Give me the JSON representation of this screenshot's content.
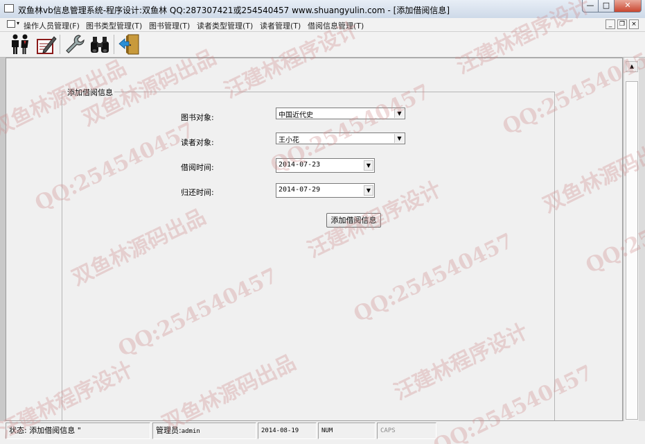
{
  "window": {
    "title": "双鱼林vb信息管理系统-程序设计:双鱼林 QQ:287307421或254540457 www.shuangyulin.com - [添加借阅信息]",
    "min_label": "—",
    "max_label": "□",
    "close_label": "✕"
  },
  "menu": {
    "items": [
      "操作人员管理(F)",
      "图书类型管理(T)",
      "图书管理(T)",
      "读者类型管理(T)",
      "读者管理(T)",
      "借阅信息管理(T)"
    ],
    "child_min": "_",
    "child_restore": "❐",
    "child_close": "×"
  },
  "toolbar": {
    "icons": [
      "people-icon",
      "edit-notebook-icon",
      "wrench-icon",
      "binoculars-icon",
      "exit-door-icon"
    ]
  },
  "form": {
    "frame_title": "添加借阅信息",
    "book_label": "图书对象:",
    "book_value": "中国近代史",
    "reader_label": "读者对象:",
    "reader_value": "王小花",
    "borrow_label": "借阅时间:",
    "borrow_date": "2014-07-23",
    "return_label": "归还时间:",
    "return_date": "2014-07-29",
    "submit_label": "添加借阅信息"
  },
  "status": {
    "state": "状态: 添加借阅信息 \"",
    "admin_label": "管理员:",
    "admin_name": "admin",
    "date": "2014-08-19",
    "num": "NUM",
    "caps": "CAPS"
  },
  "watermark": {
    "texts": [
      "双鱼林源码出品",
      "汪建林程序设计",
      "QQ:254540457"
    ]
  },
  "colors": {
    "title_bar": "#cdd9e8",
    "close_button": "#c9452f",
    "watermark": "#cd8c8c"
  }
}
